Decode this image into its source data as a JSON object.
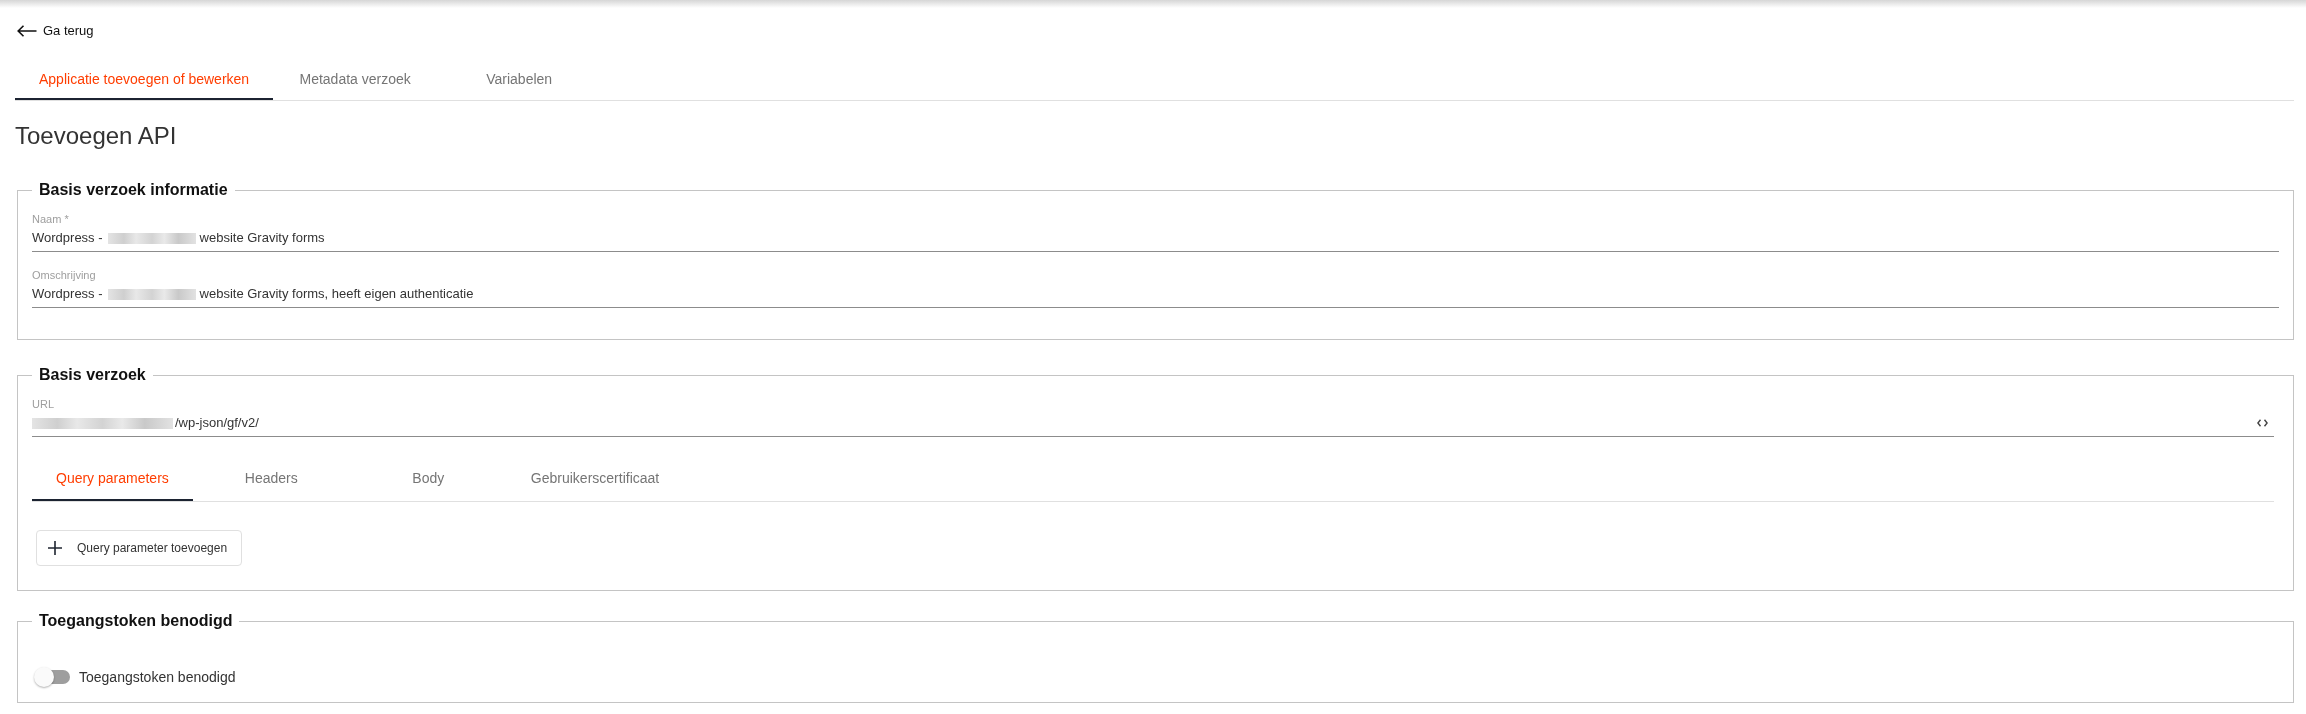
{
  "back_link": {
    "label": "Ga terug"
  },
  "tabs": [
    {
      "label": "Applicatie toevoegen of bewerken",
      "selected": true
    },
    {
      "label": "Metadata verzoek",
      "selected": false
    },
    {
      "label": "Variabelen",
      "selected": false
    }
  ],
  "heading": "Toevoegen API",
  "sections": [
    {
      "kind": "fields",
      "title": "Basis verzoek informatie",
      "fields": [
        {
          "label": "Naam *",
          "value": [
            {
              "kind": "text",
              "text": "Wordpress -"
            },
            {
              "kind": "redacted"
            },
            {
              "kind": "text",
              "text": "website Gravity forms"
            }
          ]
        },
        {
          "label": "Omschrijving",
          "value": [
            {
              "kind": "text",
              "text": "Wordpress -"
            },
            {
              "kind": "redacted"
            },
            {
              "kind": "text",
              "text": "website Gravity forms, heeft eigen authenticatie"
            }
          ]
        }
      ]
    },
    {
      "kind": "request",
      "title": "Basis verzoek",
      "url": {
        "label": "URL",
        "value": [
          {
            "kind": "redacted"
          },
          {
            "kind": "text",
            "text": "/wp-json/gf/v2/"
          }
        ]
      },
      "tabs": [
        {
          "label": "Query parameters",
          "selected": true
        },
        {
          "label": "Headers",
          "selected": false
        },
        {
          "label": "Body",
          "selected": false
        },
        {
          "label": "Gebruikerscertificaat",
          "selected": false
        }
      ],
      "button": "Query parameter toevoegen"
    },
    {
      "kind": "toggle",
      "title": "Toegangstoken benodigd",
      "toggle": {
        "label": "Toegangstoken benodigd",
        "on": false
      }
    }
  ]
}
